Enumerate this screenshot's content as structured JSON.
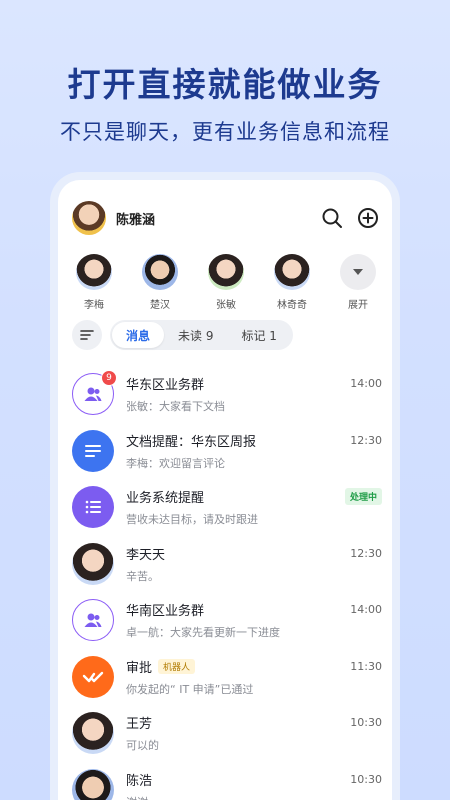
{
  "hero": {
    "headline": "打开直接就能做业务",
    "subline": "不只是聊天，更有业务信息和流程"
  },
  "header": {
    "user_name": "陈雅涵",
    "icons": [
      "search-icon",
      "add-circle-icon"
    ]
  },
  "contacts": [
    {
      "name": "李梅"
    },
    {
      "name": "楚汉"
    },
    {
      "name": "张敏"
    },
    {
      "name": "林奇奇"
    },
    {
      "name": "展开"
    }
  ],
  "tabs": [
    {
      "label": "消息",
      "active": true
    },
    {
      "label": "未读 9",
      "active": false
    },
    {
      "label": "标记 1",
      "active": false
    }
  ],
  "conversations": [
    {
      "title": "华东区业务群",
      "preview": "张敏：大家看下文档",
      "time": "14:00",
      "badge": "9",
      "icon": "group-icon"
    },
    {
      "title": "文档提醒：华东区周报",
      "preview": "李梅：欢迎留言评论",
      "time": "12:30",
      "icon": "document-icon"
    },
    {
      "title": "业务系统提醒",
      "preview": "营收未达目标，请及时跟进",
      "status": "处理中",
      "icon": "list-icon"
    },
    {
      "title": "李天天",
      "preview": "辛苦。",
      "time": "12:30",
      "icon": "avatar"
    },
    {
      "title": "华南区业务群",
      "preview": "卓一航：大家先看更新一下进度",
      "time": "14:00",
      "icon": "group-icon"
    },
    {
      "title": "审批",
      "tag": "机器人",
      "preview": "你发起的“ IT 申请”已通过",
      "time": "11:30",
      "icon": "approval-icon"
    },
    {
      "title": "王芳",
      "preview": "可以的",
      "time": "10:30",
      "icon": "avatar"
    },
    {
      "title": "陈浩",
      "preview": "谢谢",
      "time": "10:30",
      "icon": "avatar"
    }
  ],
  "colors": {
    "accent": "#2b6be8",
    "headline": "#1d3a8f",
    "badge": "#f04a4a",
    "status_green": "#1f9d47",
    "approval_orange": "#ff6a1a"
  }
}
